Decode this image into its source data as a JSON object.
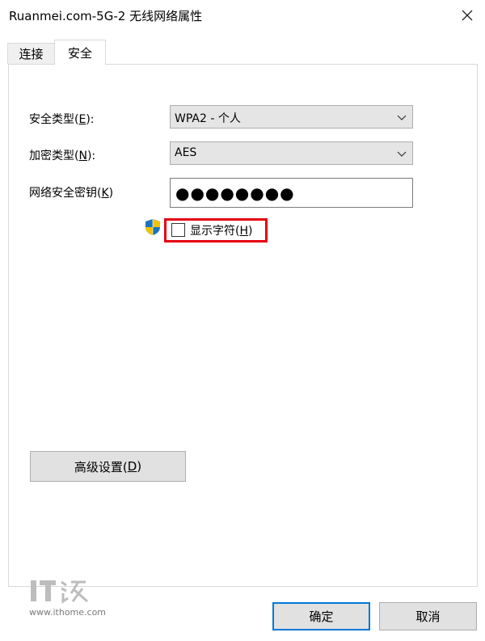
{
  "window": {
    "title": "Ruanmei.com-5G-2 无线网络属性"
  },
  "tabs": [
    {
      "label": "连接"
    },
    {
      "label": "安全"
    }
  ],
  "security": {
    "type_label_text": "安全类型(",
    "type_label_key": "E",
    "type_label_end": "):",
    "type_value": "WPA2 - 个人",
    "encryption_label_text": "加密类型(",
    "encryption_label_key": "N",
    "encryption_label_end": "):",
    "encryption_value": "AES",
    "key_label_text": "网络安全密钥(",
    "key_label_key": "K",
    "key_label_end": ")",
    "key_value": "●●●●●●●●",
    "show_chars_text": "显示字符(",
    "show_chars_key": "H",
    "show_chars_end": ")",
    "show_chars_checked": false,
    "highlight_color": "#e60012"
  },
  "buttons": {
    "advanced_text": "高级设置(",
    "advanced_key": "D",
    "advanced_end": ")",
    "ok": "确定",
    "cancel": "取消"
  },
  "watermark": {
    "logo_text": "IT之家",
    "url": "www.ithome.com"
  },
  "icons": {
    "close": "close-icon",
    "dropdown": "chevron-down-icon",
    "uac": "shield-icon"
  }
}
